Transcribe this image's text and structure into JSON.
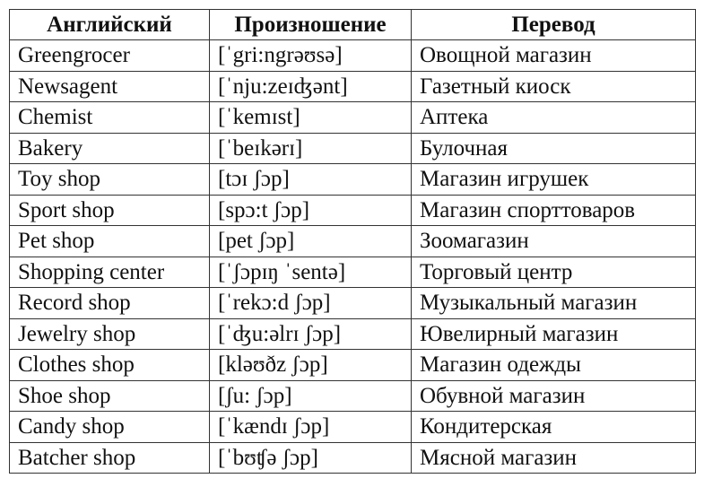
{
  "headers": [
    "Английский",
    "Произношение",
    "Перевод"
  ],
  "rows": [
    [
      "Greengrocer",
      "[ˈgri:ngrəʊsə]",
      "Овощной магазин"
    ],
    [
      "Newsagent",
      "[ˈnju:zeɪʤənt]",
      "Газетный киоск"
    ],
    [
      "Chemist",
      "[ˈkemɪst]",
      "Аптека"
    ],
    [
      "Bakery",
      "[ˈbeɪkərɪ]",
      "Булочная"
    ],
    [
      "Toy shop",
      "[tɔɪ ʃɔp]",
      "Магазин игрушек"
    ],
    [
      "Sport shop",
      "[spɔ:t ʃɔp]",
      "Магазин спорттоваров"
    ],
    [
      "Pet shop",
      "[pet ʃɔp]",
      "Зоомагазин"
    ],
    [
      "Shopping center",
      "[ˈʃɔpɪŋ ˈsentə]",
      "Торговый центр"
    ],
    [
      "Record shop",
      "[ˈrekɔ:d ʃɔp]",
      "Музыкальный магазин"
    ],
    [
      "Jewelry shop",
      "[ˈʤu:əlrɪ ʃɔp]",
      "Ювелирный магазин"
    ],
    [
      "Clothes shop",
      "[kləʊðz ʃɔp]",
      "Магазин одежды"
    ],
    [
      "Shoe shop",
      "[ʃu: ʃɔp]",
      "Обувной магазин"
    ],
    [
      "Candy shop",
      "[ˈkændɪ ʃɔp]",
      "Кондитерская"
    ],
    [
      "Batcher shop",
      "[ˈbʊʧə ʃɔp]",
      "Мясной магазин"
    ]
  ]
}
